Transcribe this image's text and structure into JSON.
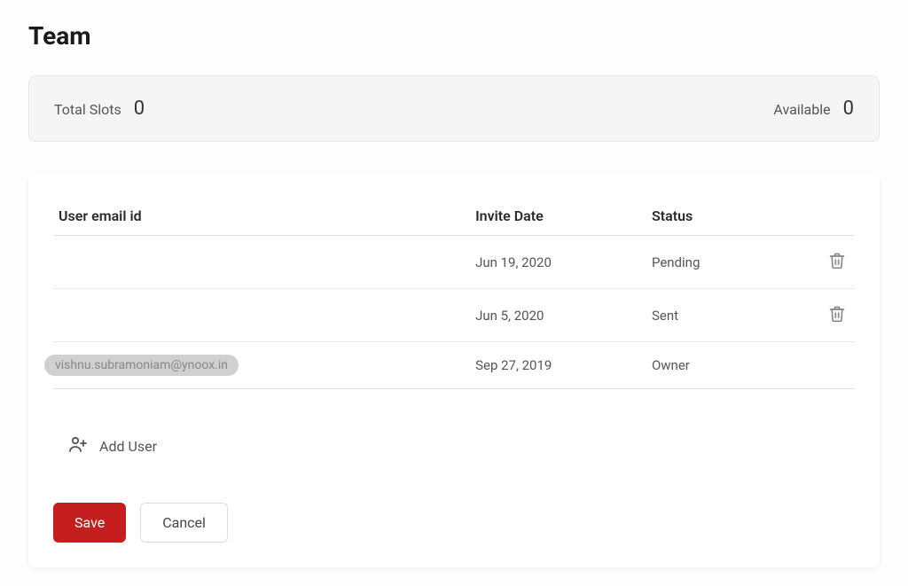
{
  "title": "Team",
  "stats": {
    "totalSlotsLabel": "Total Slots",
    "totalSlotsValue": "0",
    "availableLabel": "Available",
    "availableValue": "0"
  },
  "table": {
    "headers": {
      "email": "User email id",
      "date": "Invite Date",
      "status": "Status"
    },
    "rows": [
      {
        "email": "",
        "date": "Jun 19, 2020",
        "status": "Pending",
        "deletable": true
      },
      {
        "email": "",
        "date": "Jun 5, 2020",
        "status": "Sent",
        "deletable": true
      },
      {
        "email": "vishnu.subramoniam@ynoox.in",
        "date": "Sep 27, 2019",
        "status": "Owner",
        "deletable": false
      }
    ]
  },
  "addUserLabel": "Add User",
  "buttons": {
    "save": "Save",
    "cancel": "Cancel"
  }
}
